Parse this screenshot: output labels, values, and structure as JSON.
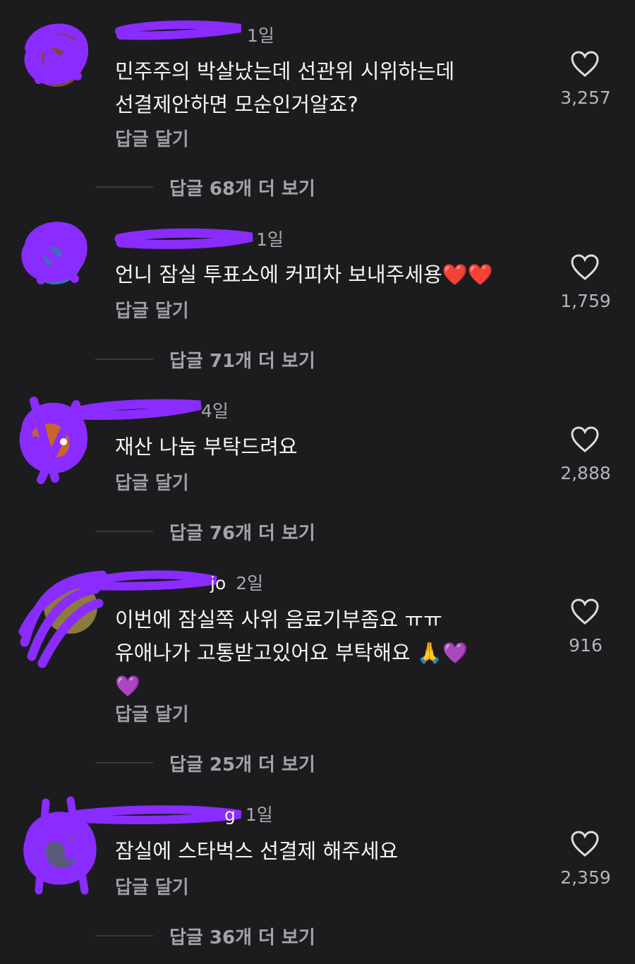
{
  "colors": {
    "background": "#1c1c1f",
    "scribble": "#8a2cff",
    "heart_red": "#e5323f",
    "heart_purple": "#9a5ce6"
  },
  "comments": [
    {
      "time": "1일",
      "text": "민주주의 박살났는데 선관위 시위하는데\n선결제안하면 모순인거알죠?",
      "reply_label": "답글 달기",
      "likes": "3,257",
      "more_replies": "답글 68개 더 보기"
    },
    {
      "time": "1일",
      "text": "언니 잠실 투표소에 커피차 보내주세용❤️❤️",
      "reply_label": "답글 달기",
      "likes": "1,759",
      "more_replies": "답글 71개 더 보기"
    },
    {
      "time": "4일",
      "text": "재산 나눔 부탁드려요",
      "reply_label": "답글 달기",
      "likes": "2,888",
      "more_replies": "답글 76개 더 보기"
    },
    {
      "time": "2일",
      "username_tail": "jo",
      "text": "이번에 잠실쪽 사위 음료기부좀요 ㅠㅠ\n유애나가 고통받고있어요 부탁해요 🙏💜\n💜",
      "reply_label": "답글 달기",
      "likes": "916",
      "more_replies": "답글 25개 더 보기"
    },
    {
      "time": "1일",
      "username_tail": "g",
      "text": "잠실에 스타벅스 선결제 해주세요",
      "reply_label": "답글 달기",
      "likes": "2,359",
      "more_replies": "답글 36개 더 보기"
    }
  ],
  "icons": {
    "like": "heart-outline-icon",
    "avatar": "avatar-redacted"
  }
}
